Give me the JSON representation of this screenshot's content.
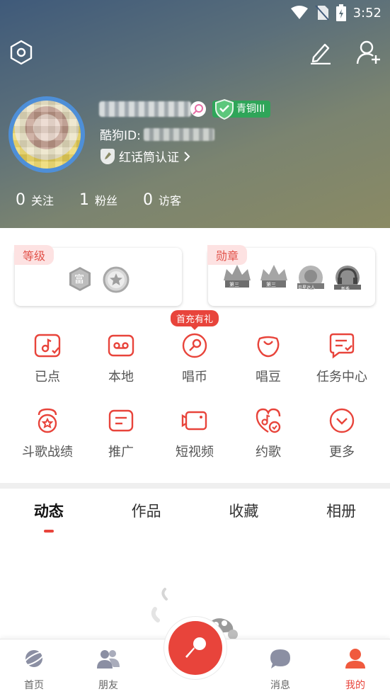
{
  "status_bar": {
    "time": "3:52"
  },
  "profile": {
    "kugou_id_label": "酷狗ID:",
    "level_badge": "青铜III",
    "certification": "红话筒认证",
    "stats": [
      {
        "num": "0",
        "label": "关注"
      },
      {
        "num": "1",
        "label": "粉丝"
      },
      {
        "num": "0",
        "label": "访客"
      }
    ]
  },
  "cards": {
    "level": {
      "tag": "等级",
      "rich_label": "富"
    },
    "medal": {
      "tag": "勋章",
      "medal_labels": [
        "第三",
        "第三",
        "巨星达人",
        "新秀"
      ]
    }
  },
  "grid": {
    "promo_pill": "首充有礼",
    "items": [
      {
        "label": "已点",
        "icon": "music-note-check-icon"
      },
      {
        "label": "本地",
        "icon": "cassette-icon"
      },
      {
        "label": "唱币",
        "icon": "coin-mic-icon"
      },
      {
        "label": "唱豆",
        "icon": "bean-icon"
      },
      {
        "label": "任务中心",
        "icon": "task-icon"
      },
      {
        "label": "斗歌战绩",
        "icon": "battle-icon"
      },
      {
        "label": "推广",
        "icon": "promote-icon"
      },
      {
        "label": "短视频",
        "icon": "video-icon"
      },
      {
        "label": "约歌",
        "icon": "invite-song-icon"
      },
      {
        "label": "更多",
        "icon": "more-icon"
      }
    ]
  },
  "tabs": [
    "动态",
    "作品",
    "收藏",
    "相册"
  ],
  "bottom_nav": [
    {
      "label": "首页",
      "icon": "planet-icon"
    },
    {
      "label": "朋友",
      "icon": "friends-icon"
    },
    {
      "label": "",
      "icon": "microphone-icon"
    },
    {
      "label": "消息",
      "icon": "chat-bubble-icon"
    },
    {
      "label": "我的",
      "icon": "user-icon"
    }
  ],
  "colors": {
    "accent": "#e8443b",
    "level_badge": "#2fa559"
  }
}
